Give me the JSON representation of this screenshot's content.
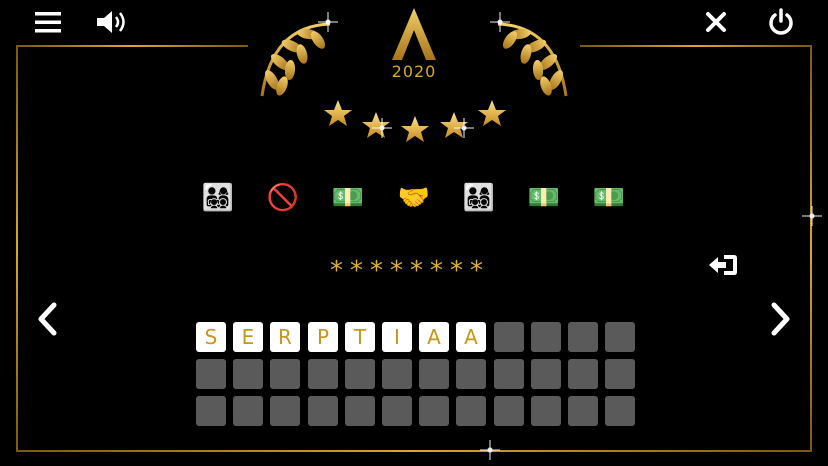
{
  "header": {
    "menu_icon": "hamburger-menu-icon",
    "sound_icon": "speaker-volume-icon",
    "close_icon": "close-x-icon",
    "power_icon": "power-icon"
  },
  "logo": {
    "year": "2020",
    "icon": "award-trophy-logo"
  },
  "rating": {
    "stars": 5,
    "icon": "star-icon"
  },
  "clues": [
    "👨‍👩‍👧‍👦",
    "🚫",
    "💵",
    "🤝",
    "👨‍👩‍👧‍👦",
    "💵",
    "💵"
  ],
  "answer_mask": "********",
  "hint_button_icon": "enter-arrow-icon",
  "nav": {
    "prev_icon": "chevron-left-icon",
    "next_icon": "chevron-right-icon"
  },
  "letters": [
    "S",
    "E",
    "R",
    "P",
    "T",
    "I",
    "A",
    "A"
  ],
  "colors": {
    "gold": "#d9a72c",
    "tile_gray": "#5a5a5a",
    "tile_white": "#ffffff",
    "letter_gold": "#c9961c"
  }
}
